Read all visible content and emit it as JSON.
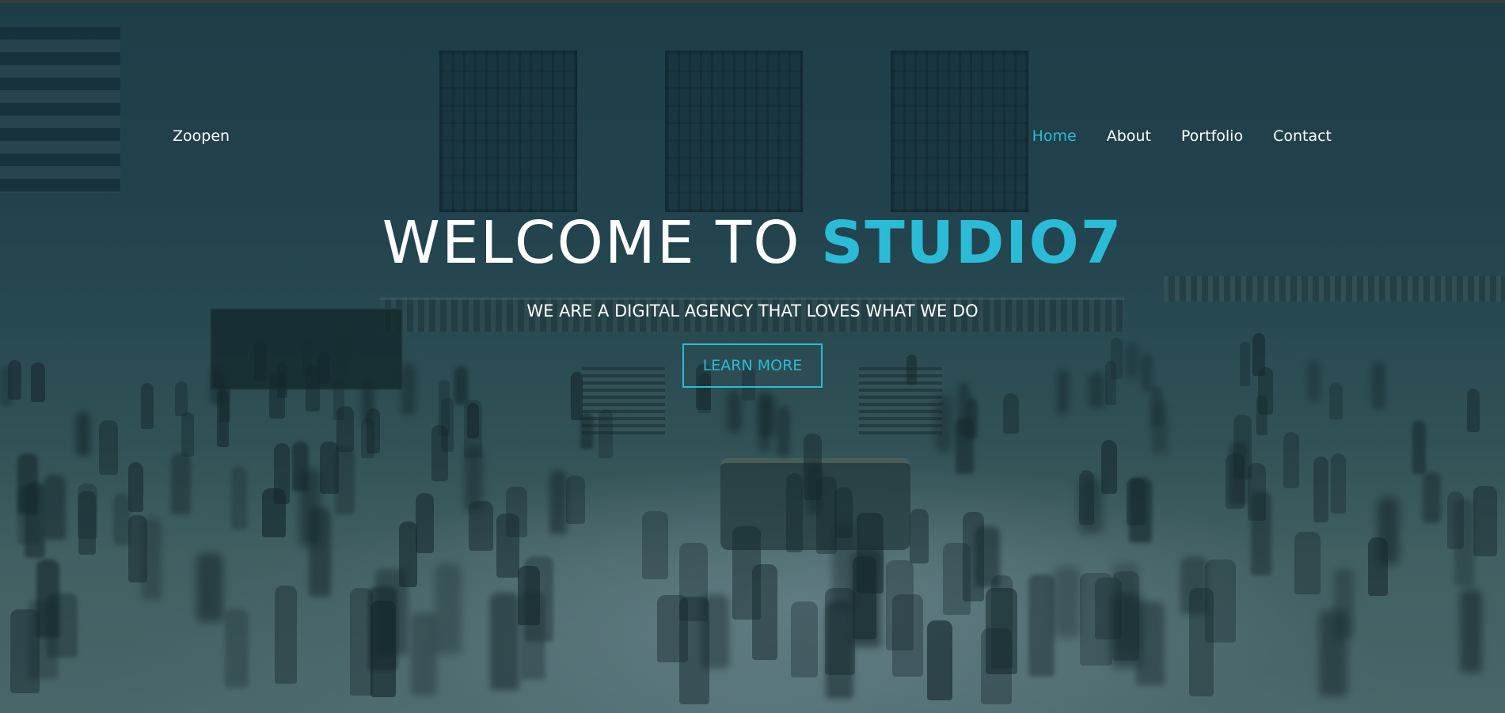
{
  "brand": {
    "name": "Zoopen"
  },
  "nav": {
    "items": [
      {
        "label": "Home",
        "active": true
      },
      {
        "label": "About",
        "active": false
      },
      {
        "label": "Portfolio",
        "active": false
      },
      {
        "label": "Contact",
        "active": false
      }
    ]
  },
  "hero": {
    "title_prefix": "WELCOME TO ",
    "title_accent": "STUDIO7",
    "subtitle": "WE ARE A DIGITAL AGENCY THAT LOVES WHAT WE DO",
    "cta_label": "LEARN MORE"
  },
  "colors": {
    "accent": "#2bbbd6",
    "overlay": "#183e48",
    "text": "#ffffff"
  }
}
